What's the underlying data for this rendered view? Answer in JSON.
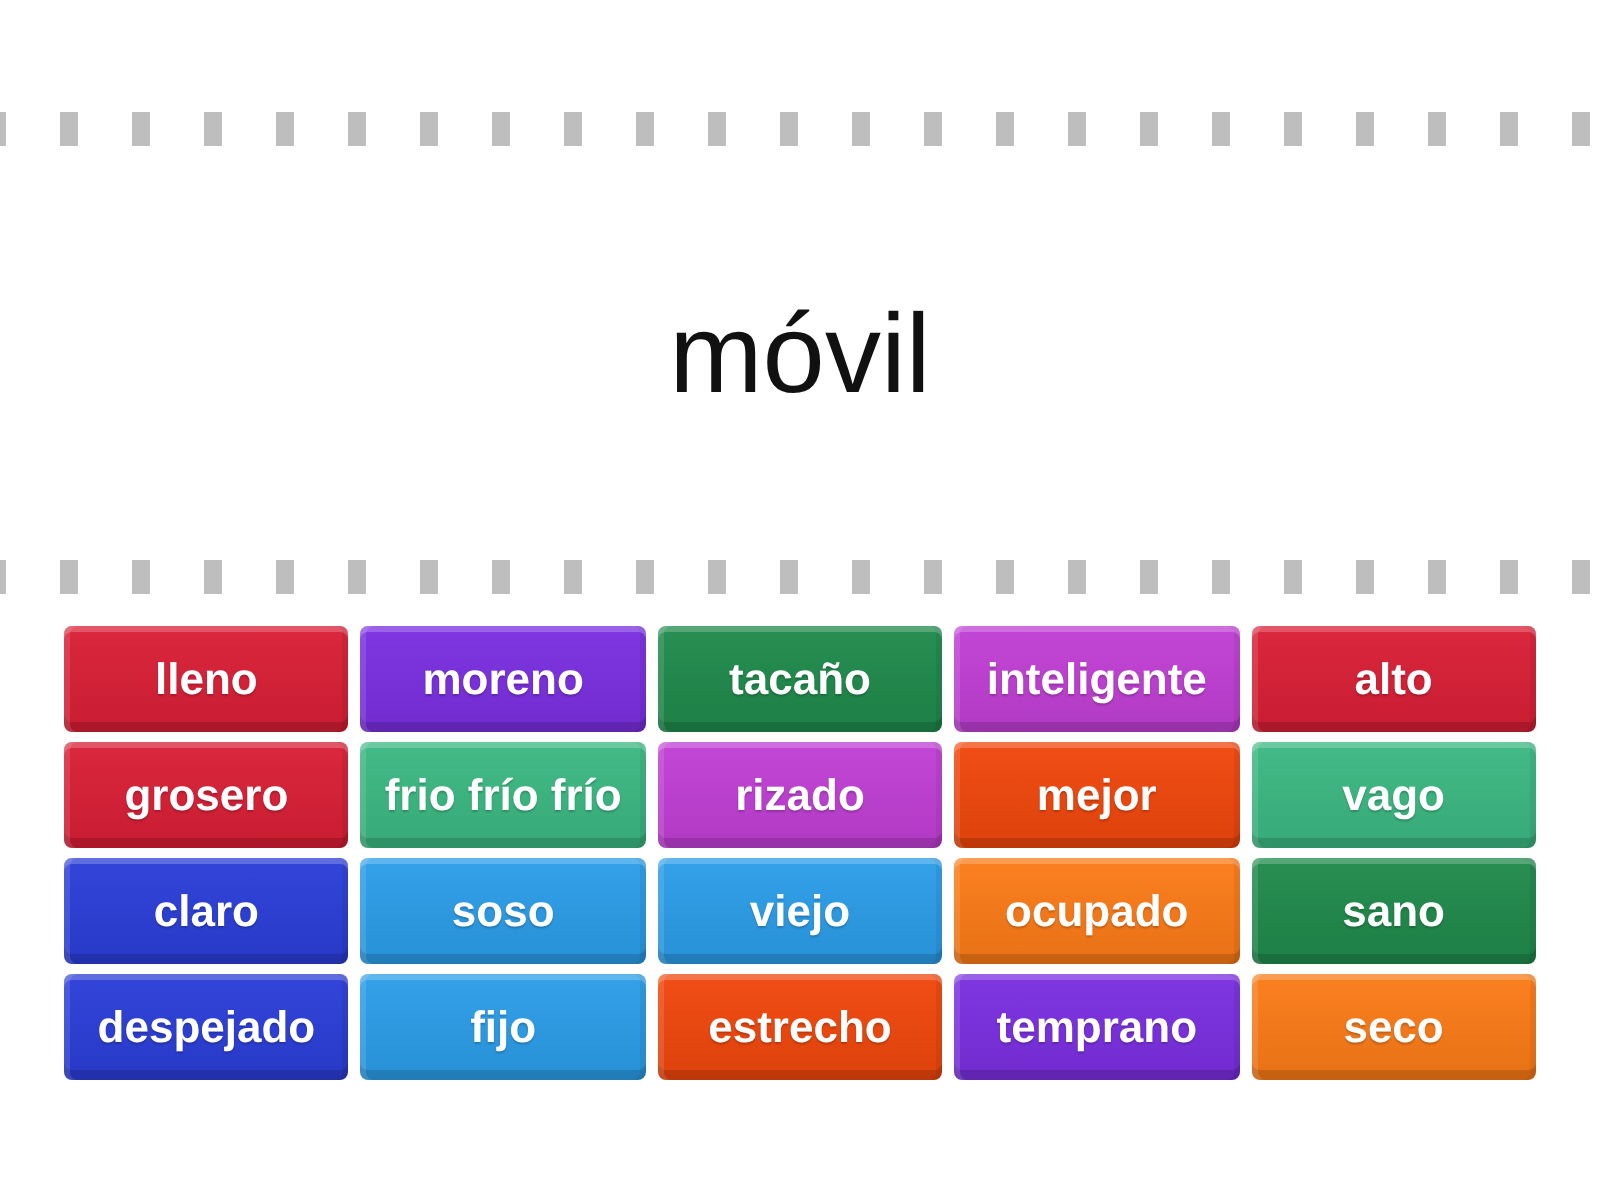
{
  "prompt": {
    "text": "móvil"
  },
  "answers": [
    {
      "label": "lleno",
      "color": "#d91f36"
    },
    {
      "label": "moreno",
      "color": "#7a2fe0"
    },
    {
      "label": "tacaño",
      "color": "#1f8a4b"
    },
    {
      "label": "inteligente",
      "color": "#c03fd4"
    },
    {
      "label": "alto",
      "color": "#d91f36"
    },
    {
      "label": "grosero",
      "color": "#d91f36"
    },
    {
      "label": "frio frío frío",
      "color": "#3bb882"
    },
    {
      "label": "rizado",
      "color": "#c03fd4"
    },
    {
      "label": "mejor",
      "color": "#f0470c"
    },
    {
      "label": "vago",
      "color": "#3bb882"
    },
    {
      "label": "claro",
      "color": "#2b3ed8"
    },
    {
      "label": "soso",
      "color": "#2b9de8"
    },
    {
      "label": "viejo",
      "color": "#2b9de8"
    },
    {
      "label": "ocupado",
      "color": "#fb7b17"
    },
    {
      "label": "sano",
      "color": "#1f8a4b"
    },
    {
      "label": "despejado",
      "color": "#2b3ed8"
    },
    {
      "label": "fijo",
      "color": "#2b9de8"
    },
    {
      "label": "estrecho",
      "color": "#f0470c"
    },
    {
      "label": "temprano",
      "color": "#7a2fe0"
    },
    {
      "label": "seco",
      "color": "#fb7b17"
    }
  ]
}
